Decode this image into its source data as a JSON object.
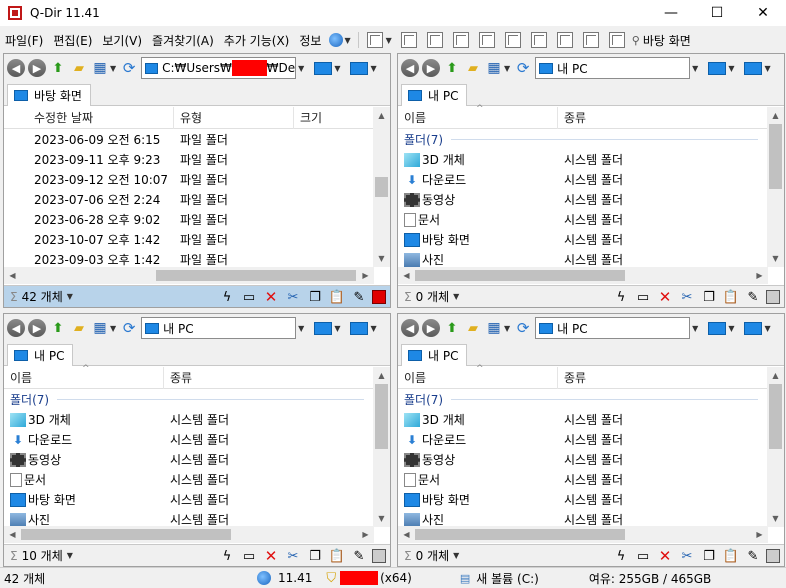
{
  "window": {
    "title": "Q-Dir 11.41",
    "minimize": "—",
    "maximize": "☐",
    "close": "✕"
  },
  "menu": {
    "items": [
      "파일(F)",
      "편집(E)",
      "보기(V)",
      "즐겨찾기(A)",
      "추가 기능(X)",
      "정보"
    ],
    "desktop_label": "바탕 화면"
  },
  "panes": [
    {
      "id": "top-left",
      "address": "C:₩Users₩",
      "address_tail": "₩De",
      "tab_label": "바탕 화면",
      "columns": [
        "수정한 날짜",
        "유형",
        "크기"
      ],
      "rows": [
        [
          "2023-06-09 오전 6:15",
          "파일 폴더",
          ""
        ],
        [
          "2023-09-11 오후 9:23",
          "파일 폴더",
          ""
        ],
        [
          "2023-09-12 오전 10:07",
          "파일 폴더",
          ""
        ],
        [
          "2023-07-06 오전 2:24",
          "파일 폴더",
          ""
        ],
        [
          "2023-06-28 오후 9:02",
          "파일 폴더",
          ""
        ],
        [
          "2023-10-07 오후 1:42",
          "파일 폴더",
          ""
        ],
        [
          "2023-09-03 오후 1:42",
          "파일 폴더",
          ""
        ]
      ],
      "count": "42 개체"
    },
    {
      "id": "top-right",
      "address": "내 PC",
      "tab_label": "내 PC",
      "columns": [
        "이름",
        "종류"
      ],
      "group": "폴더(7)",
      "rows": [
        [
          "3D 개체",
          "시스템 폴더"
        ],
        [
          "다운로드",
          "시스템 폴더"
        ],
        [
          "동영상",
          "시스템 폴더"
        ],
        [
          "문서",
          "시스템 폴더"
        ],
        [
          "바탕 화면",
          "시스템 폴더"
        ],
        [
          "사진",
          "시스템 폴더"
        ]
      ],
      "count": "0 개체"
    },
    {
      "id": "bottom-left",
      "address": "내 PC",
      "tab_label": "내 PC",
      "columns": [
        "이름",
        "종류"
      ],
      "group": "폴더(7)",
      "rows": [
        [
          "3D 개체",
          "시스템 폴더"
        ],
        [
          "다운로드",
          "시스템 폴더"
        ],
        [
          "동영상",
          "시스템 폴더"
        ],
        [
          "문서",
          "시스템 폴더"
        ],
        [
          "바탕 화면",
          "시스템 폴더"
        ],
        [
          "사진",
          "시스템 폴더"
        ]
      ],
      "count": "10 개체"
    },
    {
      "id": "bottom-right",
      "address": "내 PC",
      "tab_label": "내 PC",
      "columns": [
        "이름",
        "종류"
      ],
      "group": "폴더(7)",
      "rows": [
        [
          "3D 개체",
          "시스템 폴더"
        ],
        [
          "다운로드",
          "시스템 폴더"
        ],
        [
          "동영상",
          "시스템 폴더"
        ],
        [
          "문서",
          "시스템 폴더"
        ],
        [
          "바탕 화면",
          "시스템 폴더"
        ],
        [
          "사진",
          "시스템 폴더"
        ]
      ],
      "count": "0 개체"
    }
  ],
  "status": {
    "objects": "42 개체",
    "version": "11.41",
    "arch": "(x64)",
    "drive": "새 볼륨 (C:)",
    "free": "여유: 255GB / 465GB"
  },
  "colors": {
    "active_status": "#b8d3ea",
    "folder_header": "#1a3e8c",
    "redaction": "#ff0000"
  }
}
